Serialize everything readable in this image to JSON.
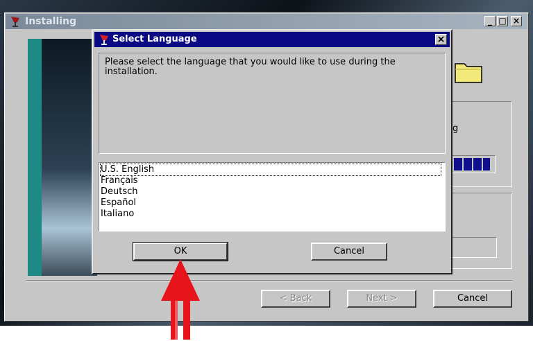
{
  "main_window": {
    "title": "Installing",
    "buttons": {
      "minimize": "_",
      "maximize": "□",
      "close": "×"
    },
    "side_text": "g",
    "footer": {
      "back_label": "< Back",
      "next_label": "Next >",
      "cancel_label": "Cancel"
    }
  },
  "dialog": {
    "title": "Select Language",
    "message": "Please select the language that you would like to use during the installation.",
    "languages": [
      "U.S. English",
      "Français",
      "Deutsch",
      "Español",
      "Italiano"
    ],
    "selected": "U.S. English",
    "ok_label": "OK",
    "cancel_label": "Cancel",
    "close_symbol": "×"
  },
  "colors": {
    "titlebar_active": "#0a0a84",
    "progress": "#10108c",
    "annotation_arrow": "#e8141c"
  },
  "icons": [
    "wine-glass-icon",
    "folder-icon",
    "red-arrow-icon"
  ]
}
